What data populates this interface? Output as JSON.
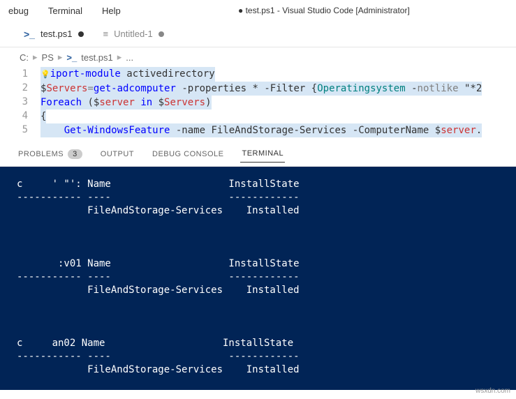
{
  "titlebar": {
    "menu": [
      "ebug",
      "Terminal",
      "Help"
    ],
    "window_title": "● test.ps1 - Visual Studio Code [Administrator]"
  },
  "tabs": [
    {
      "label": "test.ps1",
      "icon": "ps",
      "modified": true,
      "active": true
    },
    {
      "label": "Untitled-1",
      "icon": "file",
      "modified": true,
      "active": false
    }
  ],
  "breadcrumb": {
    "parts": [
      "C:",
      "PS",
      "test.ps1",
      "..."
    ],
    "ps_index": 2
  },
  "editor": {
    "lines": [
      {
        "n": "1",
        "segs": [
          {
            "t": "i",
            "c": "kw-blue",
            "bulb": true
          },
          {
            "t": "port-module",
            "c": "kw-blue"
          },
          {
            "t": " activedirectory",
            "c": "txt"
          }
        ]
      },
      {
        "n": "2",
        "segs": [
          {
            "t": "$",
            "c": "var-dark"
          },
          {
            "t": "Servers",
            "c": "var-red"
          },
          {
            "t": "=",
            "c": "op"
          },
          {
            "t": "get-adcomputer",
            "c": "kw-blue"
          },
          {
            "t": " -",
            "c": "dash"
          },
          {
            "t": "properties",
            "c": "param"
          },
          {
            "t": " * -",
            "c": "dash"
          },
          {
            "t": "Filter",
            "c": "param"
          },
          {
            "t": " {",
            "c": "txt"
          },
          {
            "t": "Operatingsystem",
            "c": "kw-teal"
          },
          {
            "t": " -",
            "c": "dash"
          },
          {
            "t": "notlike",
            "c": "op"
          },
          {
            "t": " \"*2",
            "c": "txt"
          }
        ]
      },
      {
        "n": "3",
        "segs": [
          {
            "t": "Foreach",
            "c": "kw-blue"
          },
          {
            "t": " (",
            "c": "txt"
          },
          {
            "t": "$",
            "c": "var-dark"
          },
          {
            "t": "server",
            "c": "var-red"
          },
          {
            "t": " in ",
            "c": "kw-blue"
          },
          {
            "t": "$",
            "c": "var-dark"
          },
          {
            "t": "Servers",
            "c": "var-red"
          },
          {
            "t": ")",
            "c": "txt"
          }
        ]
      },
      {
        "n": "4",
        "segs": [
          {
            "t": "{",
            "c": "txt"
          }
        ]
      },
      {
        "n": "5",
        "segs": [
          {
            "t": "    ",
            "c": "txt"
          },
          {
            "t": "Get-WindowsFeature",
            "c": "kw-blue"
          },
          {
            "t": " -",
            "c": "dash"
          },
          {
            "t": "name",
            "c": "param"
          },
          {
            "t": " FileAndStorage",
            "c": "txt"
          },
          {
            "t": "-",
            "c": "dash"
          },
          {
            "t": "Services -",
            "c": "txt"
          },
          {
            "t": "ComputerName",
            "c": "param"
          },
          {
            "t": " $",
            "c": "var-dark"
          },
          {
            "t": "server",
            "c": "var-red"
          },
          {
            "t": ".",
            "c": "txt"
          }
        ]
      }
    ]
  },
  "panel": {
    "tabs": [
      {
        "label": "PROBLEMS",
        "badge": "3",
        "active": false
      },
      {
        "label": "OUTPUT",
        "active": false
      },
      {
        "label": "DEBUG CONSOLE",
        "active": false
      },
      {
        "label": "TERMINAL",
        "active": true
      }
    ]
  },
  "terminal": {
    "blocks": [
      {
        "host": "c     ' \"': ",
        "name_hdr": "Name",
        "state_hdr": "InstallState",
        "row_name": "FileAndStorage-Services",
        "row_state": "Installed"
      },
      {
        "host": "       :v01 ",
        "name_hdr": "Name",
        "state_hdr": "InstallState",
        "row_name": "FileAndStorage-Services",
        "row_state": "Installed"
      },
      {
        "host": "c     an02 ",
        "name_hdr": "Name",
        "state_hdr": "InstallState",
        "row_name": "FileAndStorage-Services",
        "row_state": "Installed"
      }
    ]
  },
  "watermark": "wsxdn.com"
}
